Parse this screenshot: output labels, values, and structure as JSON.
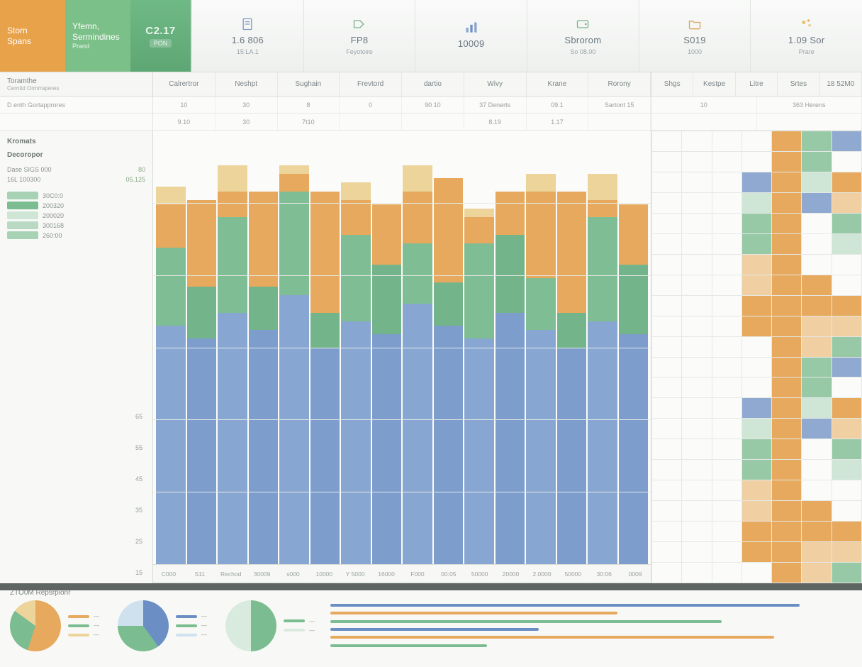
{
  "brand": {
    "tile1_line1": "Storn",
    "tile1_line2": "Spans",
    "tile2_line1": "Yfemn,",
    "tile2_line2": "Sermindines",
    "tile2_sub": "Prand",
    "badge_code": "C2.17",
    "badge_tag": "PON"
  },
  "kpis": [
    {
      "icon": "doc",
      "value": "1.6 806",
      "sub": "15:LA.1",
      "label": ""
    },
    {
      "icon": "tag",
      "value": "FP8",
      "sub": "Feyotoire",
      "label": ""
    },
    {
      "icon": "bars",
      "value": "10009",
      "sub": "",
      "label": ""
    },
    {
      "icon": "wallet",
      "value": "Sbrorom",
      "sub": "So 08.00",
      "label": ""
    },
    {
      "icon": "folder",
      "value": "S019",
      "sub": "1000",
      "label": ""
    },
    {
      "icon": "bubbles",
      "value": "1.09 Sor",
      "sub": "Prare",
      "label": ""
    }
  ],
  "columns": {
    "lead_title": "Toramthe",
    "lead_sub": "Cernitd Ormrraperes",
    "heads": [
      "Calrertror",
      "Neshpt",
      "Sughain",
      "Frevtord",
      "dartio",
      "Wivy",
      "Krane",
      "Rorony"
    ],
    "right_heads": [
      "Shgs",
      "Kestpe",
      "Litre",
      "Srtes",
      "18 52M0"
    ]
  },
  "rows": [
    {
      "lead": "D enth Gortapprores",
      "cells": [
        "10",
        "30",
        "8",
        "0",
        "90 10",
        "37 Denerts",
        "09.1",
        "Sartont 15",
        "10",
        "363 Herens"
      ]
    },
    {
      "lead": "",
      "cells": [
        "9.10",
        "30",
        "7t10",
        "",
        "",
        "8.19",
        "1.17",
        "",
        "",
        ""
      ]
    }
  ],
  "sidebar": {
    "section1": "Kromats",
    "section2": "Decoropor",
    "rows": [
      {
        "k": "Dase SIGS 000",
        "v": "80"
      },
      {
        "k": "16L 100300",
        "v": "05.125"
      }
    ],
    "legend": [
      {
        "label": "30C0:0",
        "color": "#a7d3b4"
      },
      {
        "label": "200320",
        "color": "#7bbd90"
      },
      {
        "label": "200020",
        "color": "#cfe6d6"
      },
      {
        "label": "300168",
        "color": "#b9d9c3"
      },
      {
        "label": "260:00",
        "color": "#a7d3b4"
      }
    ],
    "yticks": [
      "65",
      "55",
      "45",
      "35",
      "25",
      "15"
    ]
  },
  "xaxis": [
    "C000",
    "S11",
    "Rechod",
    "30009",
    "s000",
    "10000",
    "Y 5000",
    "16000",
    "F000",
    "00:05",
    "50000",
    "20000",
    "2.0000",
    "50000",
    "30:06",
    "0009"
  ],
  "footer_title": "ZTO0M Repsrpionr",
  "chart_data": {
    "type": "bar",
    "stacked": true,
    "title": "",
    "xlabel": "",
    "ylabel": "",
    "ylim": [
      0,
      100
    ],
    "categories": [
      "C000",
      "S11",
      "Rechod",
      "30009",
      "s000",
      "10000",
      "Y 5000",
      "16000",
      "F000",
      "00:05",
      "50000",
      "20000",
      "2.0000",
      "50000",
      "30:06",
      "0009"
    ],
    "series": [
      {
        "name": "blue",
        "color": "#7d9dcd",
        "values": [
          55,
          52,
          58,
          54,
          62,
          50,
          56,
          53,
          60,
          55,
          52,
          58,
          54,
          50,
          56,
          53
        ]
      },
      {
        "name": "green",
        "color": "#74b48a",
        "values": [
          18,
          12,
          22,
          10,
          24,
          8,
          20,
          16,
          14,
          10,
          22,
          18,
          12,
          8,
          24,
          16
        ]
      },
      {
        "name": "orange",
        "color": "#e7a95e",
        "values": [
          10,
          20,
          6,
          22,
          4,
          28,
          8,
          14,
          12,
          24,
          6,
          10,
          20,
          28,
          4,
          14
        ]
      },
      {
        "name": "yellow",
        "color": "#ecd49a",
        "values": [
          4,
          0,
          6,
          0,
          2,
          0,
          4,
          0,
          6,
          0,
          2,
          0,
          4,
          0,
          6,
          0
        ]
      }
    ],
    "heatmap": {
      "rows": 22,
      "cols": 7,
      "note": "right-side calendar-style heatmap; colors green/orange/blue"
    },
    "pies": [
      {
        "slices": [
          {
            "label": "a",
            "value": 55,
            "color": "#e7a95e"
          },
          {
            "label": "b",
            "value": 30,
            "color": "#7bbd90"
          },
          {
            "label": "c",
            "value": 15,
            "color": "#ecd49a"
          }
        ]
      },
      {
        "slices": [
          {
            "label": "a",
            "value": 40,
            "color": "#6b8fc4"
          },
          {
            "label": "b",
            "value": 35,
            "color": "#7bbd90"
          },
          {
            "label": "c",
            "value": 25,
            "color": "#cfe0ef"
          }
        ]
      },
      {
        "slices": [
          {
            "label": "a",
            "value": 50,
            "color": "#7bbd90"
          },
          {
            "label": "b",
            "value": 50,
            "color": "#d9ebdf"
          }
        ]
      }
    ],
    "hlines": [
      {
        "len": 0.9,
        "color": "#6b8fc4"
      },
      {
        "len": 0.55,
        "color": "#e7a95e"
      },
      {
        "len": 0.75,
        "color": "#7bbd90"
      },
      {
        "len": 0.4,
        "color": "#6b8fc4"
      },
      {
        "len": 0.85,
        "color": "#e7a95e"
      },
      {
        "len": 0.3,
        "color": "#7bbd90"
      }
    ]
  }
}
